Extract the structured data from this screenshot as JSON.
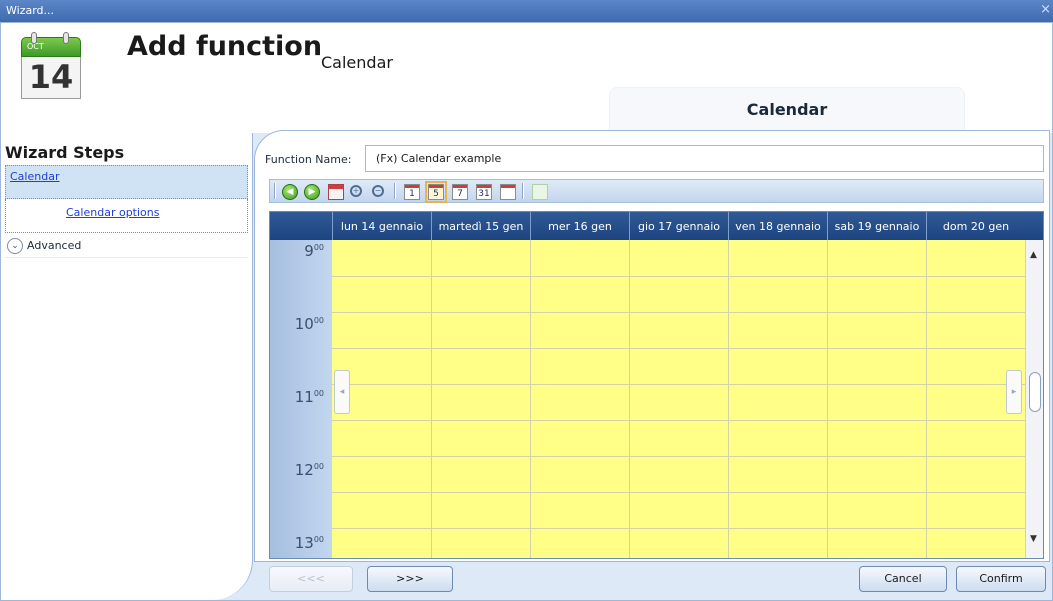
{
  "window": {
    "title": "Wizard...",
    "close_glyph": "×"
  },
  "header": {
    "icon": {
      "name": "calendar-icon",
      "month": "OCT",
      "day": "14",
      "accent": "#3f9a28"
    },
    "title": "Add function",
    "subtitle": "Calendar",
    "section_tab": "Calendar"
  },
  "wizard": {
    "title": "Wizard Steps",
    "step": "Calendar",
    "substep": "Calendar options",
    "advanced": "Advanced",
    "chevron_glyph": "⌄"
  },
  "form": {
    "function_name_label": "Function Name:",
    "function_name_value": "(Fx) Calendar example"
  },
  "toolbar": {
    "cal_day": "1",
    "cal_week": "5",
    "cal_7": "7",
    "cal_month": "31"
  },
  "calendar": {
    "columns": [
      "lun 14 gennaio",
      "martedì 15 gen",
      "mer 16 gen",
      "gio 17 gennaio",
      "ven 18 gennaio",
      "sab 19 gennaio",
      "dom 20 gen"
    ],
    "hours": [
      {
        "h": "9",
        "m": "00"
      },
      {
        "h": "10",
        "m": "00"
      },
      {
        "h": "11",
        "m": "00"
      },
      {
        "h": "12",
        "m": "00"
      },
      {
        "h": "13",
        "m": "00"
      }
    ],
    "cell_color": "#ffff88",
    "header_color": "#1e4480",
    "scroll_up": "▲",
    "scroll_down": "▼",
    "handle_left": "◂",
    "handle_right": "▸"
  },
  "footer": {
    "back": "<<<",
    "next": ">>>",
    "cancel": "Cancel",
    "confirm": "Confirm"
  }
}
